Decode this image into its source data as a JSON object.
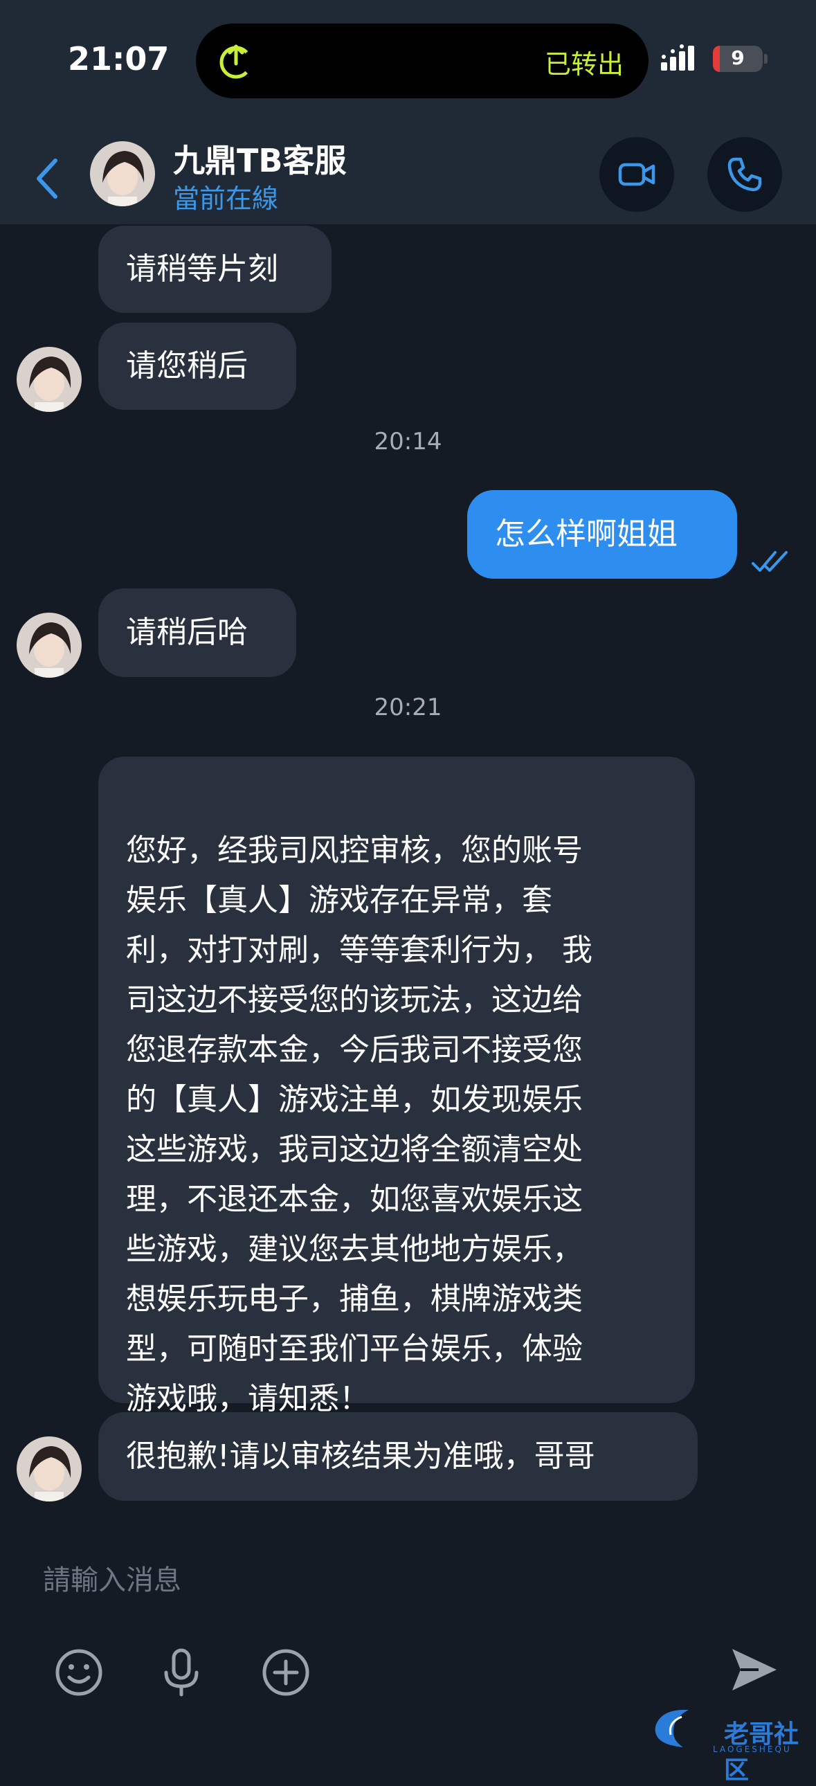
{
  "status_bar": {
    "time": "21:07",
    "island_text": "已转出",
    "battery_level": "9"
  },
  "header": {
    "title": "九鼎TB客服",
    "subtitle": "當前在線"
  },
  "messages": [
    {
      "side": "in",
      "text": "请稍等片刻"
    },
    {
      "side": "in",
      "text": "请您稍后"
    },
    {
      "type": "timestamp",
      "text": "20:14"
    },
    {
      "side": "out",
      "text": "怎么样啊姐姐",
      "status": "read"
    },
    {
      "side": "in",
      "text": "请稍后哈"
    },
    {
      "type": "timestamp",
      "text": "20:21"
    },
    {
      "side": "in",
      "text": "您好，经我司风控审核，您的账号\n娱乐【真人】游戏存在异常，套\n利，对打对刷，等等套利行为， 我\n司这边不接受您的该玩法，这边给\n您退存款本金，今后我司不接受您\n的【真人】游戏注单，如发现娱乐\n这些游戏，我司这边将全额清空处\n理，不退还本金，如您喜欢娱乐这\n些游戏，建议您去其他地方娱乐，\n想娱乐玩电子，捕鱼，棋牌游戏类\n型，可随时至我们平台娱乐，体验\n游戏哦，请知悉！"
    },
    {
      "side": "in",
      "text": "很抱歉!请以审核结果为准哦，哥哥"
    }
  ],
  "composer": {
    "placeholder": "請輸入消息"
  },
  "watermark": {
    "text": "老哥社区",
    "sub": "LAOGESHEQU"
  },
  "colors": {
    "background": "#141b24",
    "header": "#202a36",
    "incoming_bubble": "#28313d",
    "outgoing_bubble": "#2e8ef0",
    "accent": "#3b97ea"
  }
}
